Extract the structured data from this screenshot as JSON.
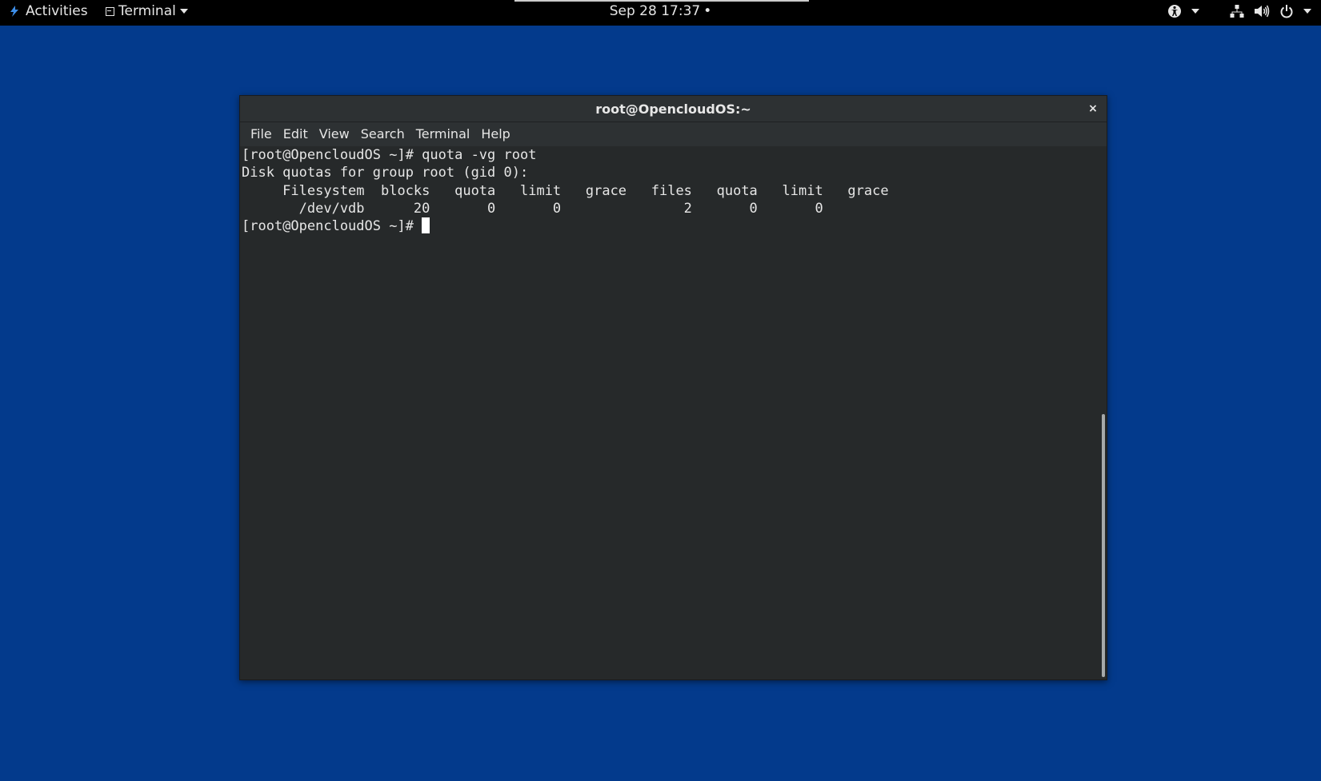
{
  "topbar": {
    "activities_label": "Activities",
    "app_menu_label": "Terminal",
    "clock": "Sep 28  17:37",
    "clock_indicator": "•",
    "tray_icons": [
      "accessibility-icon",
      "network-icon",
      "volume-icon",
      "power-icon"
    ]
  },
  "window": {
    "title": "root@OpencloudOS:~",
    "close_label": "×",
    "menu": [
      "File",
      "Edit",
      "View",
      "Search",
      "Terminal",
      "Help"
    ]
  },
  "terminal": {
    "lines": [
      "[root@OpencloudOS ~]# quota -vg root",
      "Disk quotas for group root (gid 0):",
      "     Filesystem  blocks   quota   limit   grace   files   quota   limit   grace",
      "       /dev/vdb      20       0       0               2       0       0        "
    ],
    "prompt": "[root@OpencloudOS ~]# "
  },
  "colors": {
    "desktop": "#033a8c",
    "terminal_bg": "#26292a",
    "terminal_fg": "#e6e6e6",
    "topbar": "#000000"
  }
}
